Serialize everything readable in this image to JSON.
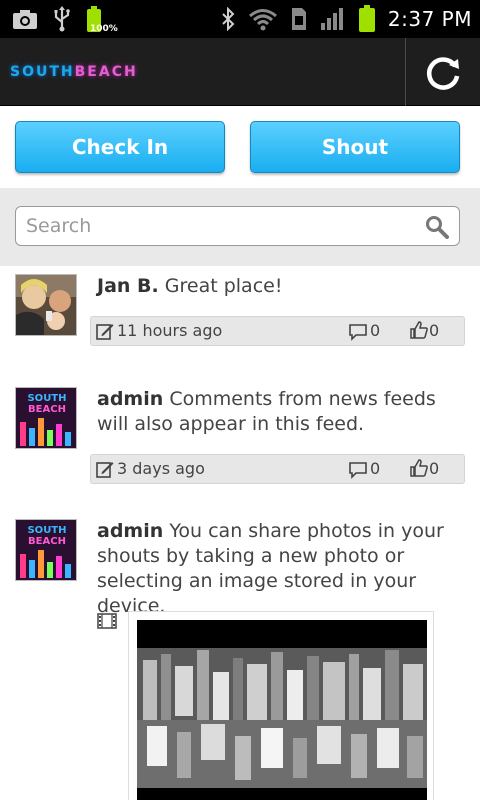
{
  "status_bar": {
    "time": "2:37 PM",
    "battery_percent_label": "100%",
    "left_icons": [
      "camera-icon",
      "usb-icon",
      "battery-full-icon"
    ],
    "right_icons": [
      "bluetooth-icon",
      "wifi-icon",
      "sim-icon",
      "signal-icon",
      "battery-icon"
    ]
  },
  "header": {
    "logo_part1": "SOUTH",
    "logo_part2": "BEACH",
    "refresh_icon": "refresh-icon"
  },
  "actions": {
    "checkin_label": "Check In",
    "shout_label": "Shout"
  },
  "search": {
    "placeholder": "Search",
    "value": ""
  },
  "feed": [
    {
      "author": "Jan B.",
      "message": "Great place!",
      "time": "11 hours ago",
      "comments": "0",
      "likes": "0"
    },
    {
      "author": "admin",
      "message": "Comments from news feeds will also appear in this feed.",
      "time": "3 days ago",
      "comments": "0",
      "likes": "0"
    },
    {
      "author": "admin",
      "message": "You can share photos in your shouts by taking a new photo or selecting an image stored in your device.",
      "time": "",
      "comments": "",
      "likes": ""
    }
  ],
  "colors": {
    "accent": "#19aef0",
    "header_bg": "#1e1e1e",
    "status_bg": "#000000",
    "battery_green": "#9fe000"
  }
}
